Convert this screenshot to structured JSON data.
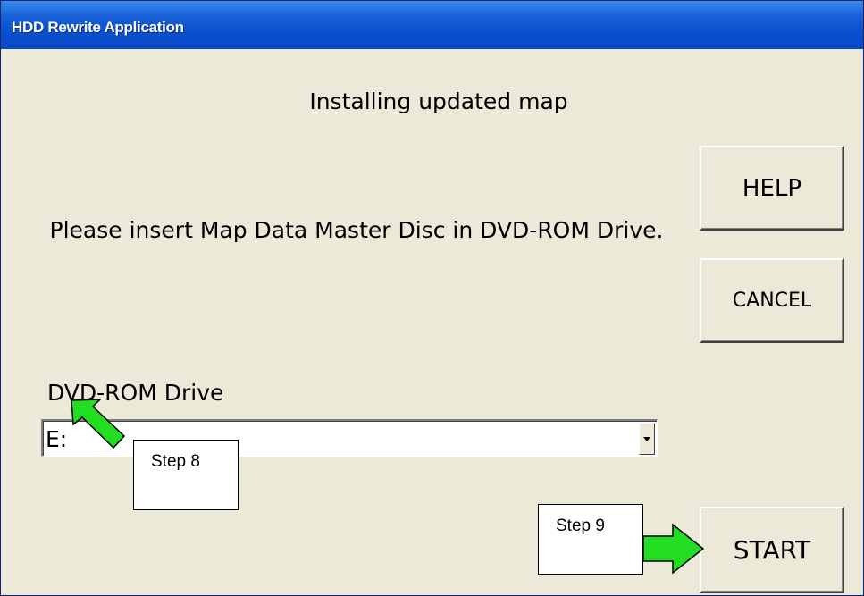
{
  "window": {
    "title": "HDD Rewrite Application"
  },
  "main": {
    "heading": "Installing updated map",
    "message": "Please insert Map Data Master Disc in DVD-ROM Drive.",
    "drive_label": "DVD-ROM Drive",
    "drive_value": "E:"
  },
  "buttons": {
    "help": "HELP",
    "cancel": "CANCEL",
    "start": "START"
  },
  "annotations": {
    "step8": "Step 8",
    "step9": "Step 9",
    "arrow_color": "#22dd22"
  },
  "icons": {
    "dropdown": "chevron-down-icon",
    "step8_arrow": "arrow-up-left-icon",
    "step9_arrow": "arrow-right-icon"
  }
}
